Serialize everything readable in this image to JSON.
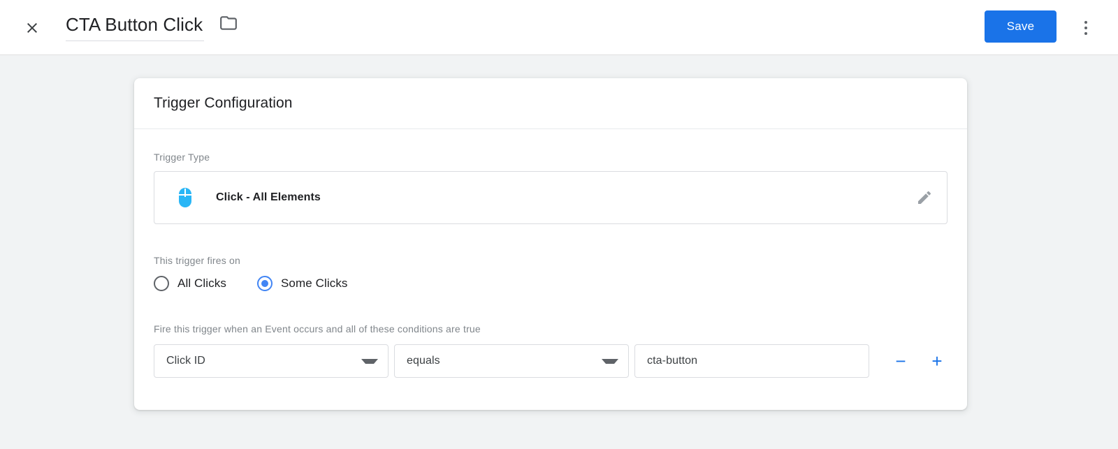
{
  "appbar": {
    "close_icon": "close-icon",
    "title": "CTA Button Click",
    "folder_icon": "folder-icon",
    "save_label": "Save",
    "overflow_icon": "more-vert-icon",
    "accent_color": "#1a73e8"
  },
  "card": {
    "header_title": "Trigger Configuration",
    "trigger_type": {
      "label": "Trigger Type",
      "icon": "mouse-click-icon",
      "icon_color": "#29b6f6",
      "name": "Click - All Elements",
      "edit_icon": "pencil-icon"
    },
    "fires_on": {
      "label": "This trigger fires on",
      "options": [
        {
          "label": "All Clicks",
          "selected": false
        },
        {
          "label": "Some Clicks",
          "selected": true
        }
      ],
      "selected_color": "#4285f4"
    },
    "conditions": {
      "hint": "Fire this trigger when an Event occurs and all of these conditions are true",
      "rows": [
        {
          "variable": "Click ID",
          "operator": "equals",
          "value": "cta-button",
          "value_placeholder": "",
          "remove_label": "−",
          "add_label": "+"
        }
      ]
    }
  }
}
